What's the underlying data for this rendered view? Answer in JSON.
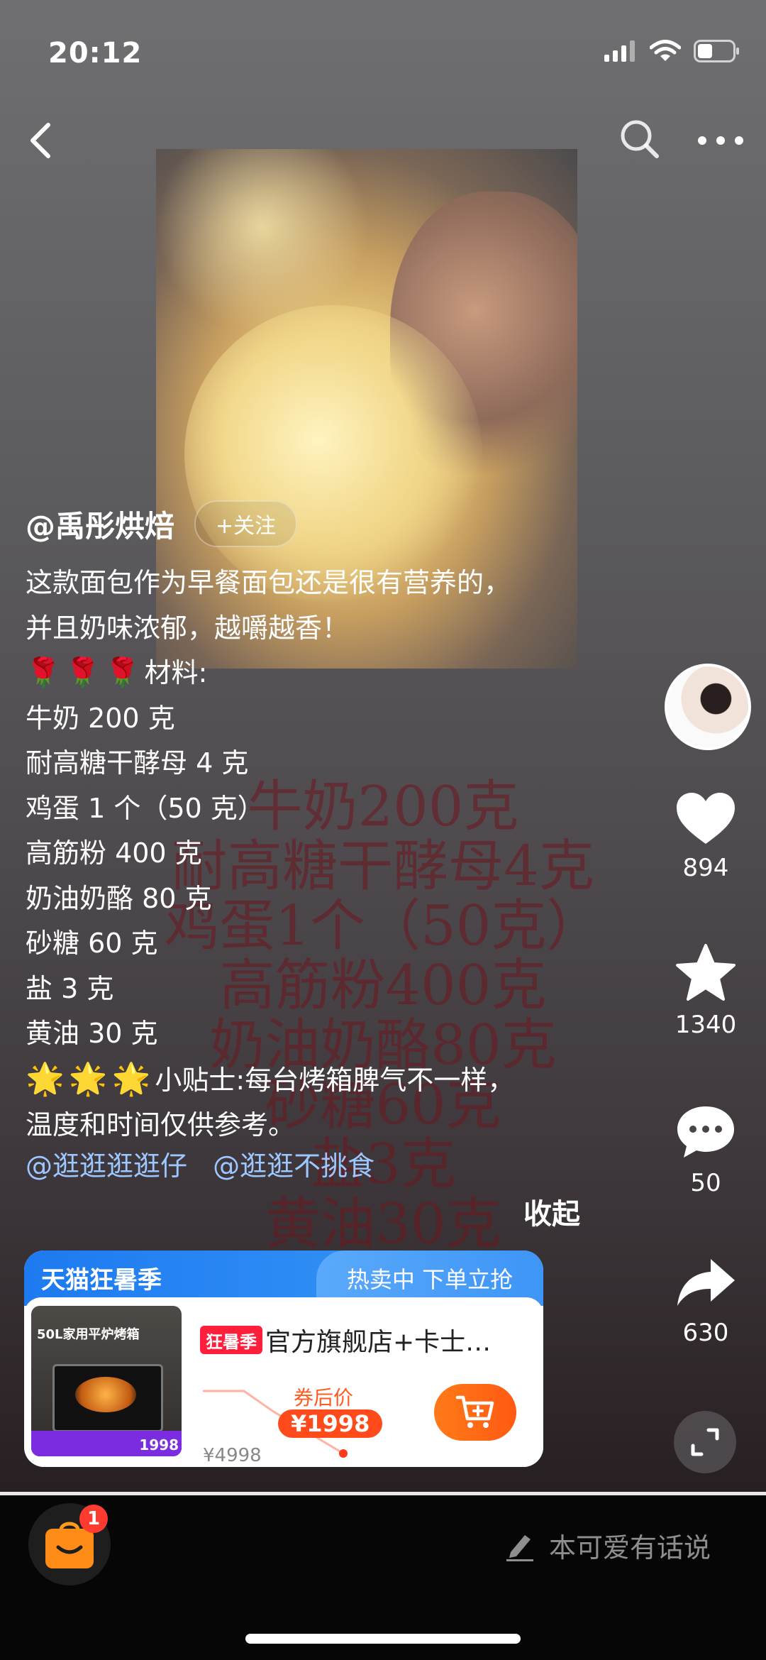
{
  "status_bar": {
    "time": "20:12"
  },
  "author": {
    "name": "@禹彤烘焙",
    "follow_label": "+关注"
  },
  "description": {
    "lines": [
      "这款面包作为早餐面包还是很有营养的，",
      "并且奶味浓郁，越嚼越香！",
      "材料:",
      "牛奶 200 克",
      "耐高糖干酵母 4 克",
      "鸡蛋 1 个（50 克）",
      "高筋粉 400 克",
      "奶油奶酪 80 克",
      "砂糖 60 克",
      "盐 3 克",
      "黄油 30 克",
      "小贴士:每台烤箱脾气不一样，",
      "温度和时间仅供参考。"
    ],
    "mentions": [
      "@逛逛逛逛仔",
      "@逛逛不挑食"
    ],
    "collapse_label": "收起"
  },
  "video_overlay": {
    "lines": [
      "牛奶200克",
      "耐高糖干酵母4克",
      "鸡蛋1个（50克）",
      "高筋粉400克",
      "奶油奶酪80克",
      "砂糖60克",
      "盐3克",
      "黄油30克"
    ]
  },
  "actions": {
    "likes": "894",
    "favorites": "1340",
    "comments": "50",
    "shares": "630"
  },
  "product_card": {
    "brand": "天猫狂暑季",
    "hot_label": "热卖中 下单立抢",
    "promo_badge": "狂暑季",
    "title": "官方旗舰店+卡士…",
    "coupon_label": "券后价",
    "coupon_price": "¥1998",
    "original_price": "¥4998",
    "image_title": "50L家用平炉烤箱",
    "image_price": "1998"
  },
  "bottom_bar": {
    "cart_badge": "1",
    "comment_placeholder": "本可爱有话说"
  },
  "icons": [
    "back-icon",
    "search-icon",
    "more-icon",
    "heart-icon",
    "star-icon",
    "comment-icon",
    "share-icon",
    "fullscreen-icon",
    "cart-icon",
    "edit-icon",
    "shopping-bag-icon"
  ],
  "colors": {
    "mention": "#9dc7ff",
    "card_header": "#1d7af0",
    "price_accent": "#ff4a1c",
    "badge": "#ff3b30"
  }
}
